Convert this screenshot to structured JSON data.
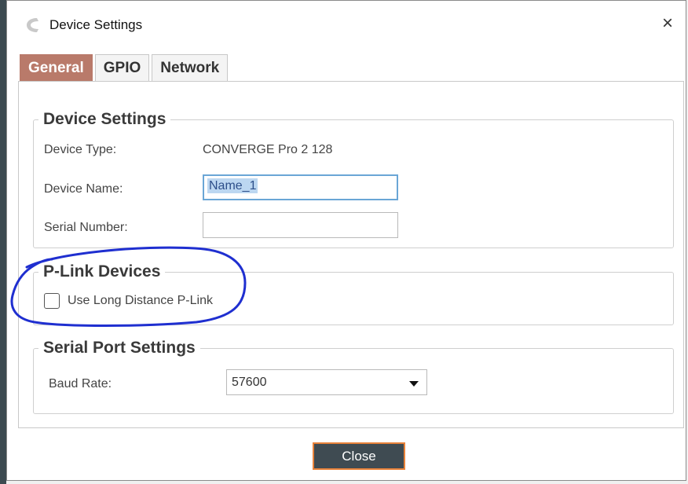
{
  "window": {
    "title": "Device Settings",
    "close_symbol": "×"
  },
  "tabs": [
    {
      "label": "General",
      "active": true
    },
    {
      "label": "GPIO",
      "active": false
    },
    {
      "label": "Network",
      "active": false
    }
  ],
  "device_settings": {
    "legend": "Device Settings",
    "device_type_label": "Device Type:",
    "device_type_value": "CONVERGE Pro 2 128",
    "device_name_label": "Device Name:",
    "device_name_value": "Name_1",
    "serial_number_label": "Serial Number:",
    "serial_number_value": ""
  },
  "plink": {
    "legend": "P-Link Devices",
    "checkbox_label": "Use Long Distance P-Link",
    "checked": false
  },
  "serial_port": {
    "legend": "Serial Port Settings",
    "baud_rate_label": "Baud Rate:",
    "baud_rate_value": "57600"
  },
  "footer": {
    "close_label": "Close"
  },
  "colors": {
    "active_tab": "#b97a6a",
    "close_button_bg": "#3f4b52",
    "close_button_border": "#e8823a",
    "annotation": "#1f2fd0"
  }
}
